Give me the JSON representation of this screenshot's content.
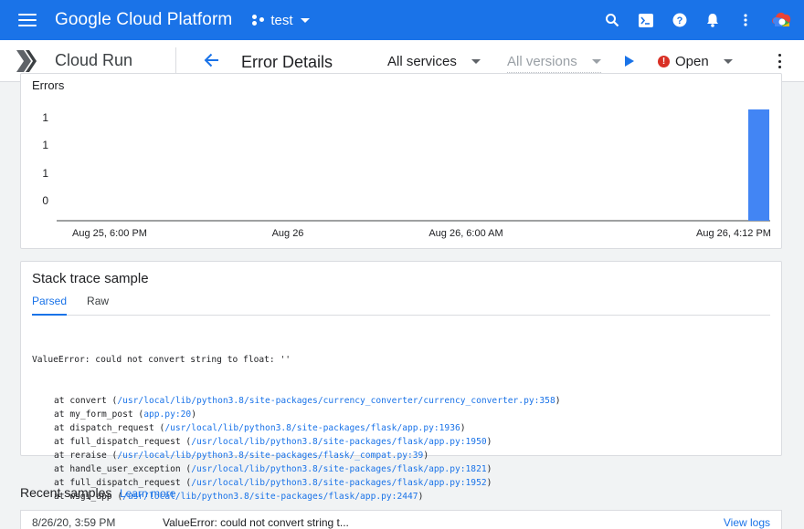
{
  "topbar": {
    "title": "Google Cloud Platform",
    "project": "test",
    "icons": [
      "menu-icon",
      "project-icon",
      "search-icon",
      "cloud-shell-icon",
      "help-icon",
      "notifications-icon",
      "more-vert-icon",
      "avatar"
    ]
  },
  "subbar": {
    "product": "Cloud Run",
    "page_title": "Error Details",
    "services": "All services",
    "versions": "All versions",
    "status": "Open",
    "status_icon": "!"
  },
  "errors_card": {
    "title": "Errors"
  },
  "chart_data": {
    "type": "bar",
    "title": "Errors",
    "x_ticks": [
      "Aug 25, 6:00 PM",
      "Aug 26",
      "Aug 26, 6:00 AM",
      "Aug 26, 4:12 PM"
    ],
    "y_ticks": [
      "1",
      "1",
      "1",
      "0"
    ],
    "series": [
      {
        "values": [
          1
        ]
      }
    ],
    "bar_positions": [
      "Aug 26, 4:12 PM"
    ],
    "color": "#4285f4",
    "grid": false
  },
  "stack_card": {
    "title": "Stack trace sample",
    "tabs": [
      "Parsed",
      "Raw"
    ],
    "error_line": "ValueError: could not convert string to float: ''",
    "frames": [
      {
        "fn": "convert",
        "path": "/usr/local/lib/python3.8/site-packages/currency_converter/currency_converter.py:358"
      },
      {
        "fn": "my_form_post",
        "path": "app.py:20"
      },
      {
        "fn": "dispatch_request",
        "path": "/usr/local/lib/python3.8/site-packages/flask/app.py:1936"
      },
      {
        "fn": "full_dispatch_request",
        "path": "/usr/local/lib/python3.8/site-packages/flask/app.py:1950"
      },
      {
        "fn": "reraise",
        "path": "/usr/local/lib/python3.8/site-packages/flask/_compat.py:39"
      },
      {
        "fn": "handle_user_exception",
        "path": "/usr/local/lib/python3.8/site-packages/flask/app.py:1821"
      },
      {
        "fn": "full_dispatch_request",
        "path": "/usr/local/lib/python3.8/site-packages/flask/app.py:1952"
      },
      {
        "fn": "wsgi_app",
        "path": "/usr/local/lib/python3.8/site-packages/flask/app.py:2447"
      }
    ]
  },
  "recent": {
    "title": "Recent samples",
    "learn_more": "Learn more",
    "rows": [
      {
        "time": "8/26/20, 3:59 PM",
        "message": "ValueError: could not convert string t...",
        "action": "View logs"
      }
    ]
  }
}
